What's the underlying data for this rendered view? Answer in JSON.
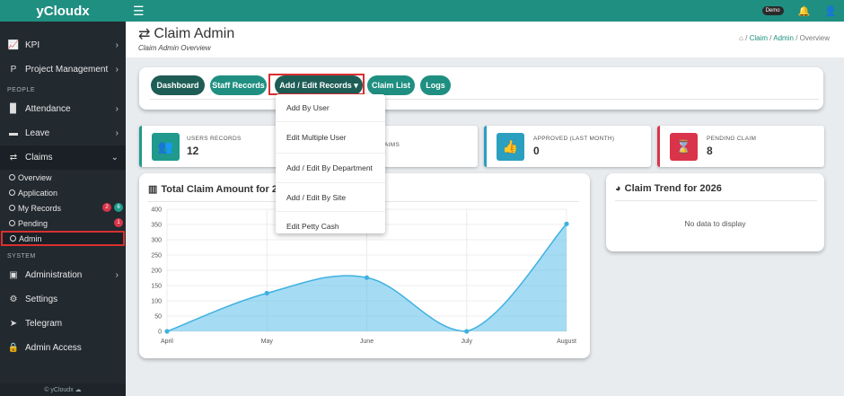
{
  "brand": "yCloudx",
  "sidebar": {
    "kpi": "KPI",
    "project": "Project Management",
    "people_section": "PEOPLE",
    "attendance": "Attendance",
    "leave": "Leave",
    "claims": "Claims",
    "sub": [
      "Overview",
      "Application",
      "My Records",
      "Pending",
      "Admin"
    ],
    "myrecords_badges": [
      "2",
      "6"
    ],
    "pending_badge": "1",
    "system_section": "SYSTEM",
    "administration": "Administration",
    "settings": "Settings",
    "telegram": "Telegram",
    "admin_access": "Admin Access",
    "footer": "© yCloudx"
  },
  "topbar": {
    "demo": "Demo"
  },
  "page": {
    "title": "Claim Admin",
    "subtitle": "Claim Admin Overview"
  },
  "breadcrumb": {
    "sep": "/",
    "claim": "Claim",
    "admin": "Admin",
    "current": "Overview"
  },
  "toolbar": {
    "dashboard": "Dashboard",
    "staff": "Staff Records",
    "addedit": "Add / Edit Records",
    "claimlist": "Claim List",
    "logs": "Logs"
  },
  "dropdown": [
    "Add By User",
    "Edit Multiple User",
    "Add / Edit By Department",
    "Add / Edit By Site",
    "Edit Petty Cash"
  ],
  "stats": [
    {
      "label": "USERS RECORDS",
      "value": "12",
      "color": "#1f9a8c"
    },
    {
      "label": "AIMS",
      "value": "",
      "color": "#3aa0c8"
    },
    {
      "label": "APPROVED (LAST MONTH)",
      "value": "0",
      "color": "#2a9fc0"
    },
    {
      "label": "PENDING CLAIM",
      "value": "8",
      "color": "#d9344a"
    }
  ],
  "chart_title": "Total Claim Amount for 20",
  "trend": {
    "title": "Claim Trend for 2026",
    "empty": "No data to display"
  },
  "chart_data": {
    "type": "area",
    "categories": [
      "April",
      "May",
      "June",
      "July",
      "August"
    ],
    "values": [
      0,
      125,
      176,
      0,
      352
    ],
    "ylim": [
      0,
      400
    ],
    "yticks": [
      0,
      50,
      100,
      150,
      200,
      250,
      300,
      350,
      400
    ],
    "color": "#5bc0eb"
  }
}
